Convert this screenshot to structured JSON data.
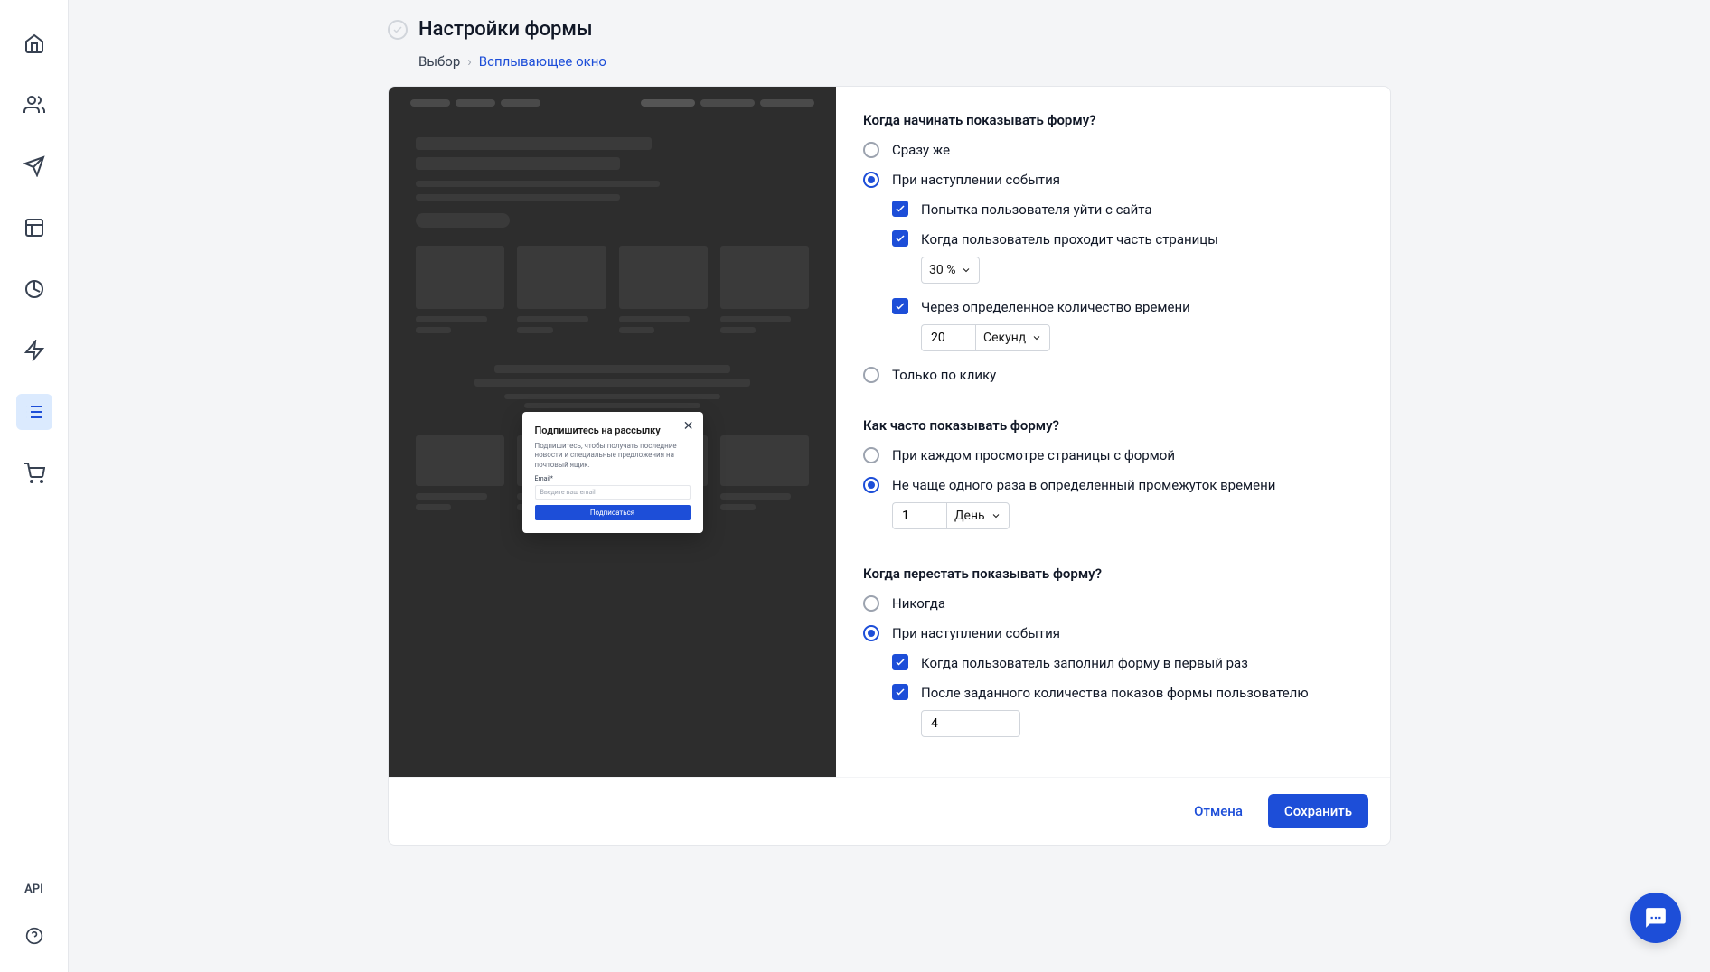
{
  "sidebar": {
    "api": "API"
  },
  "header": {
    "title": "Настройки формы",
    "breadcrumb_root": "Выбор",
    "breadcrumb_current": "Всплывающее окно"
  },
  "popup": {
    "title": "Подпишитесь на рассылку",
    "text": "Подпишитесь, чтобы получать последние новости и специальные предложения на почтовый ящик.",
    "label": "Email*",
    "placeholder": "Введите ваш email",
    "button": "Подписаться"
  },
  "when_start": {
    "title": "Когда начинать показывать форму?",
    "opt_immediate": "Сразу же",
    "opt_event": "При наступлении события",
    "chk_exit": "Попытка пользователя уйти с сайта",
    "chk_scroll": "Когда пользователь проходит часть страницы",
    "scroll_value": "30 %",
    "chk_time": "Через определенное количество времени",
    "time_value": "20",
    "time_unit": "Секунд",
    "opt_click": "Только по клику"
  },
  "how_often": {
    "title": "Как часто показывать форму?",
    "opt_every": "При каждом просмотре страницы с формой",
    "opt_interval": "Не чаще одного раза в определенный промежуток времени",
    "interval_value": "1",
    "interval_unit": "День"
  },
  "when_stop": {
    "title": "Когда перестать показывать форму?",
    "opt_never": "Никогда",
    "opt_event": "При наступлении события",
    "chk_filled": "Когда пользователь заполнил форму в первый раз",
    "chk_count": "После заданного количества показов формы пользователю",
    "count_value": "4"
  },
  "footer": {
    "cancel": "Отмена",
    "save": "Сохранить"
  }
}
